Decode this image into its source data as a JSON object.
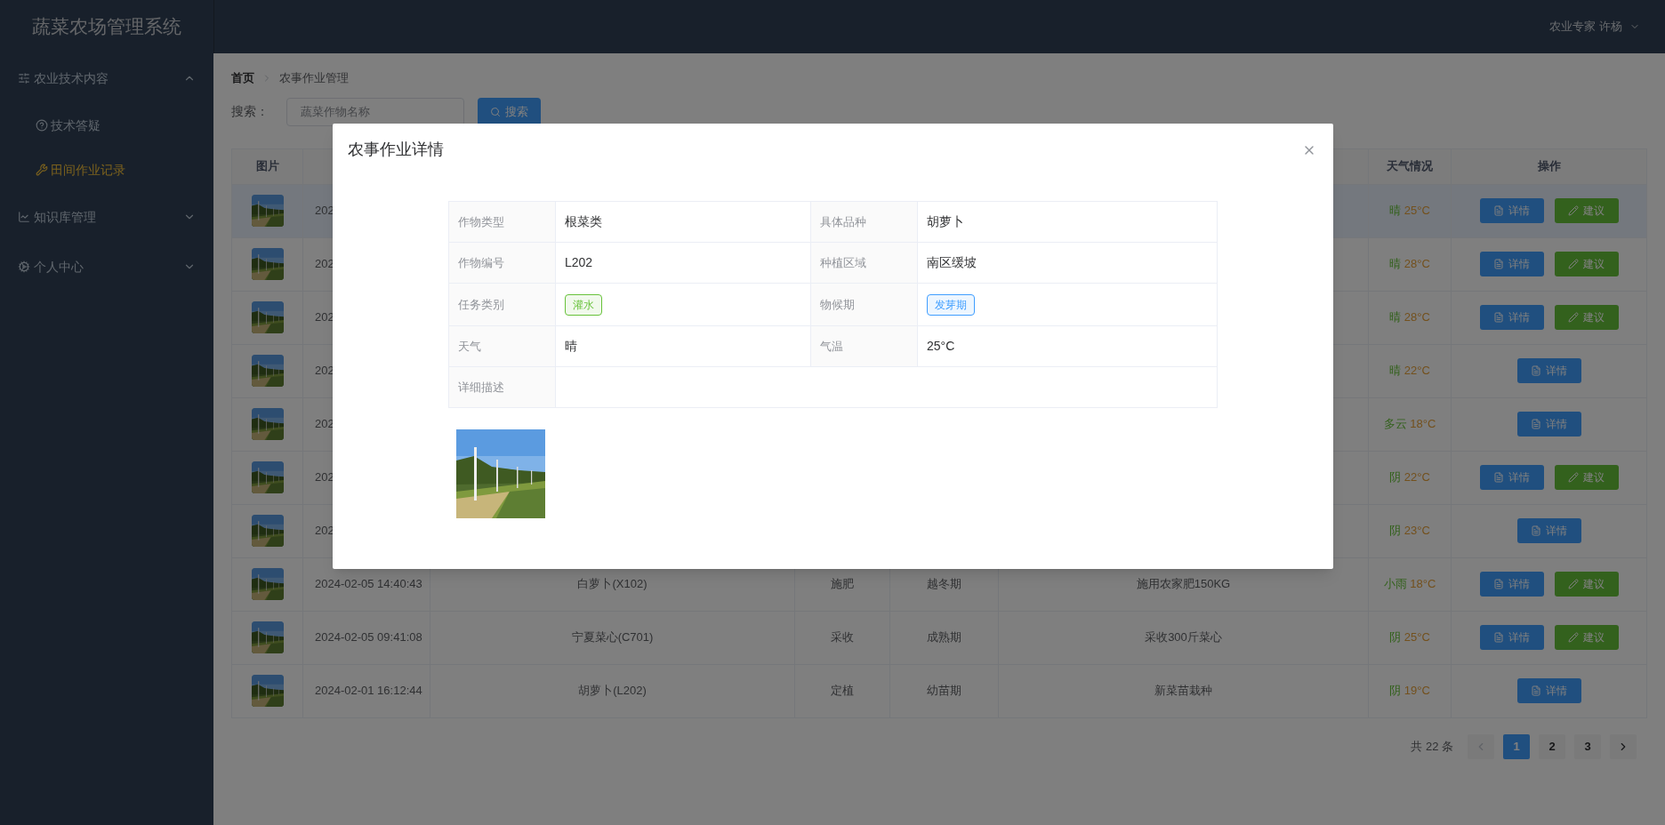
{
  "app": {
    "title": "蔬菜农场管理系统"
  },
  "header": {
    "user": "农业专家 许杨"
  },
  "sidebar": {
    "items": [
      {
        "label": "农业技术内容",
        "expanded": true,
        "children": [
          {
            "label": "技术答疑",
            "selected": false
          },
          {
            "label": "田间作业记录",
            "selected": true
          }
        ]
      },
      {
        "label": "知识库管理",
        "expanded": false
      },
      {
        "label": "个人中心",
        "expanded": false
      }
    ]
  },
  "breadcrumb": [
    "首页",
    "农事作业管理"
  ],
  "search": {
    "label": "搜索：",
    "placeholder": "蔬菜作物名称",
    "button": "搜索"
  },
  "table": {
    "columns": {
      "picture": "图片",
      "weather": "天气情况",
      "actions": "操作"
    },
    "rows": [
      {
        "selected": true,
        "time": "202",
        "weather": "晴",
        "temperature": "25°C",
        "actions": [
          {
            "kind": "detail",
            "label": "详情"
          },
          {
            "kind": "advise",
            "label": "建议"
          }
        ]
      },
      {
        "selected": false,
        "time": "202",
        "weather": "晴",
        "temperature": "28°C",
        "actions": [
          {
            "kind": "detail",
            "label": "详情"
          },
          {
            "kind": "advise",
            "label": "建议"
          }
        ]
      },
      {
        "selected": false,
        "time": "202",
        "weather": "晴",
        "temperature": "28°C",
        "actions": [
          {
            "kind": "detail",
            "label": "详情"
          },
          {
            "kind": "advise",
            "label": "建议"
          }
        ]
      },
      {
        "selected": false,
        "time": "202",
        "weather": "晴",
        "temperature": "22°C",
        "actions": [
          {
            "kind": "detail",
            "label": "详情"
          }
        ]
      },
      {
        "selected": false,
        "time": "202",
        "weather": "多云",
        "temperature": "18°C",
        "actions": [
          {
            "kind": "detail",
            "label": "详情"
          }
        ]
      },
      {
        "selected": false,
        "time": "202",
        "weather": "阴",
        "temperature": "22°C",
        "actions": [
          {
            "kind": "detail",
            "label": "详情"
          },
          {
            "kind": "advise",
            "label": "建议"
          }
        ]
      },
      {
        "selected": false,
        "time": "202",
        "weather": "阴",
        "temperature": "23°C",
        "actions": [
          {
            "kind": "detail",
            "label": "详情"
          }
        ]
      },
      {
        "selected": false,
        "time": "2024-02-05 14:40:43",
        "crop": "白萝卜(X102)",
        "task": "施肥",
        "phase": "越冬期",
        "description": "施用农家肥150KG",
        "weather": "小雨",
        "temperature": "18°C",
        "actions": [
          {
            "kind": "detail",
            "label": "详情"
          },
          {
            "kind": "advise",
            "label": "建议"
          }
        ]
      },
      {
        "selected": false,
        "time": "2024-02-05 09:41:08",
        "crop": "宁夏菜心(C701)",
        "task": "采收",
        "phase": "成熟期",
        "description": "采收300斤菜心",
        "weather": "阴",
        "temperature": "25°C",
        "actions": [
          {
            "kind": "detail",
            "label": "详情"
          },
          {
            "kind": "advise",
            "label": "建议"
          }
        ]
      },
      {
        "selected": false,
        "time": "2024-02-01 16:12:44",
        "crop": "胡萝卜(L202)",
        "task": "定植",
        "phase": "幼苗期",
        "description": "新菜苗栽种",
        "weather": "阴",
        "temperature": "19°C",
        "actions": [
          {
            "kind": "detail",
            "label": "详情"
          }
        ]
      }
    ]
  },
  "pagination": {
    "total": "共 22 条",
    "prev": {
      "disabled": true
    },
    "next": {
      "disabled": false
    },
    "pages": [
      {
        "label": "1",
        "selected": true
      },
      {
        "label": "2",
        "selected": false
      },
      {
        "label": "3",
        "selected": false
      }
    ]
  },
  "modal": {
    "title": "农事作业详情",
    "rows": [
      [
        {
          "label": "作物类型",
          "value": "根菜类"
        },
        {
          "label": "具体品种",
          "value": "胡萝卜"
        }
      ],
      [
        {
          "label": "作物编号",
          "value": "L202"
        },
        {
          "label": "种植区域",
          "value": "南区缓坡"
        }
      ],
      [
        {
          "label": "任务类别",
          "value": "灌水",
          "kind": "tag",
          "color": "#67c23a"
        },
        {
          "label": "物候期",
          "value": "发芽期",
          "kind": "tag",
          "color": "#409eff"
        }
      ],
      [
        {
          "label": "天气",
          "value": "晴"
        },
        {
          "label": "气温",
          "value": "25°C"
        }
      ],
      [
        {
          "label": "详细描述"
        }
      ]
    ],
    "image": {
      "kind": "picture"
    }
  }
}
